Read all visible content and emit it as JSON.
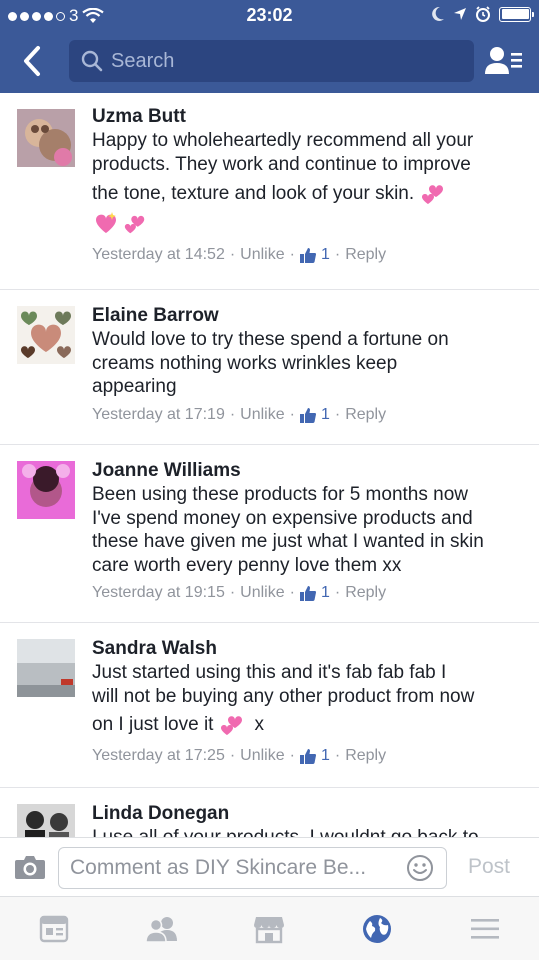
{
  "status_bar": {
    "carrier": "3",
    "time": "23:02"
  },
  "nav": {
    "search_placeholder": "Search"
  },
  "comments": [
    {
      "name": "Uzma Butt",
      "lines": [
        "Happy to wholeheartedly recommend all your",
        "products. They work and continue to improve",
        "the tone, texture and look of your skin."
      ],
      "time": "Yesterday at 14:52",
      "unlike": "Unlike",
      "likes": "1",
      "reply": "Reply"
    },
    {
      "name": "Elaine Barrow",
      "lines": [
        "Would love to try these spend a fortune on",
        "creams nothing works wrinkles keep",
        "appearing"
      ],
      "time": "Yesterday at 17:19",
      "unlike": "Unlike",
      "likes": "1",
      "reply": "Reply"
    },
    {
      "name": "Joanne Williams",
      "lines": [
        "Been using these products for 5 months now",
        "I've spend money on expensive products and",
        "these have given me just what I wanted in skin",
        "care worth every penny love them xx"
      ],
      "time": "Yesterday at 19:15",
      "unlike": "Unlike",
      "likes": "1",
      "reply": "Reply"
    },
    {
      "name": "Sandra Walsh",
      "lines": [
        "Just started using this and it's fab fab fab I",
        "will not be buying any other product from now",
        "on I just love it"
      ],
      "line_end": "x",
      "time": "Yesterday at 17:25",
      "unlike": "Unlike",
      "likes": "1",
      "reply": "Reply"
    },
    {
      "name": "Linda Donegan",
      "lines": [
        "I use all of your products. I wouldnt go back to"
      ]
    }
  ],
  "composer": {
    "placeholder": "Comment as DIY Skincare Be...",
    "post_label": "Post"
  },
  "tabs": [
    {
      "icon": "news-feed-icon"
    },
    {
      "icon": "friends-icon"
    },
    {
      "icon": "marketplace-icon"
    },
    {
      "icon": "notifications-globe-icon"
    },
    {
      "icon": "menu-icon"
    }
  ],
  "colors": {
    "brand": "#3b5998",
    "link": "#4267b2",
    "meta": "#90949c",
    "active_tab": "#4267b2",
    "inactive_tab": "#b5b9c0"
  }
}
